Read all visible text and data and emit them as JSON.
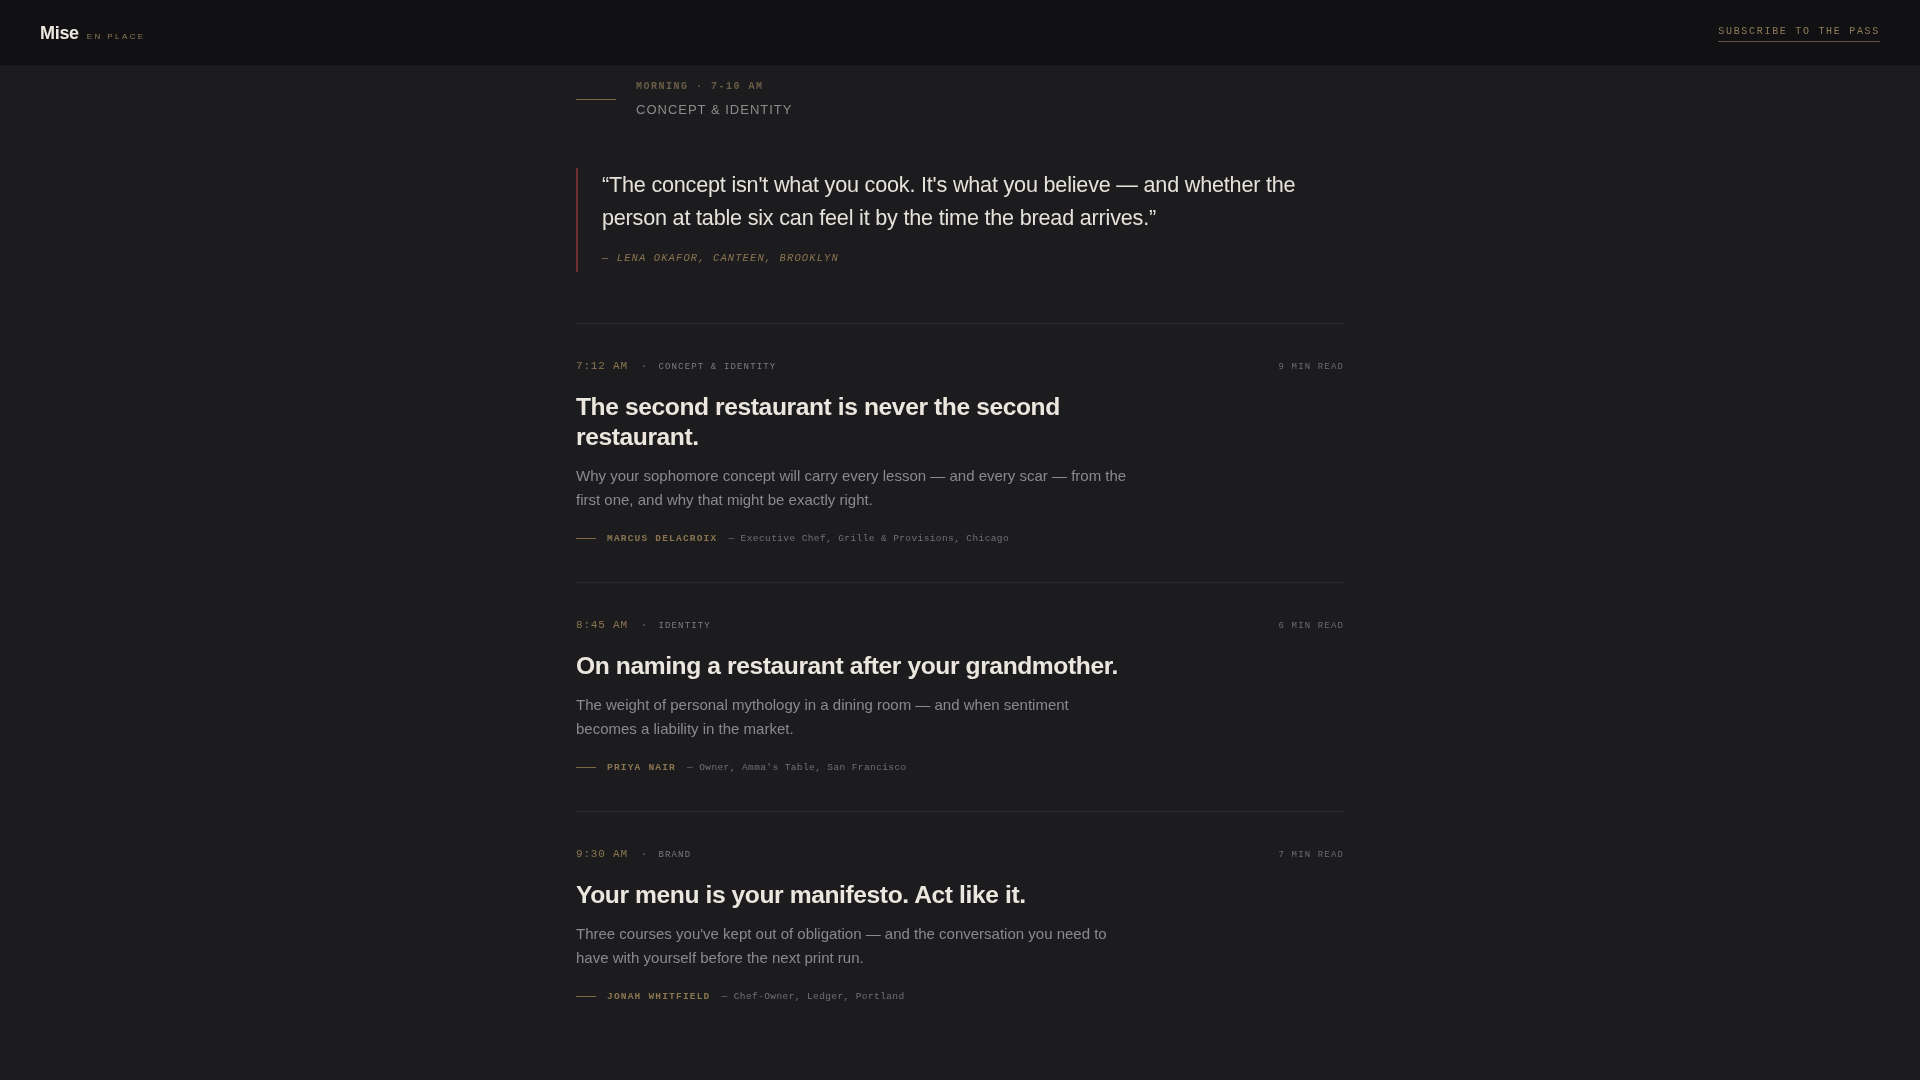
{
  "header": {
    "logo": "Mise",
    "tagline": "EN PLACE",
    "subscribe_link": "SUBSCRIBE TO THE PASS"
  },
  "section": {
    "time_label": "MORNING · 7-10 AM",
    "title": "CONCEPT & IDENTITY"
  },
  "quote": {
    "text": "“The concept isn't what you cook. It's what you believe — and whether the person at table six can feel it by the time the bread arrives.”",
    "attribution": "— LENA OKAFOR, CANTEEN, BROOKLYN"
  },
  "articles": [
    {
      "time": "7:12 AM",
      "separator": "·",
      "category": "CONCEPT & IDENTITY",
      "read_time": "9 MIN READ",
      "title": "The second restaurant is never the second restaurant.",
      "summary": "Why your sophomore concept will carry every lesson — and every scar — from the first one, and why that might be exactly right.",
      "author": "MARCUS DELACROIX",
      "author_role": "— Executive Chef, Grille & Provisions, Chicago"
    },
    {
      "time": "8:45 AM",
      "separator": "·",
      "category": "IDENTITY",
      "read_time": "6 MIN READ",
      "title": "On naming a restaurant after your grandmother.",
      "summary": "The weight of personal mythology in a dining room — and when sentiment becomes a liability in the market.",
      "author": "PRIYA NAIR",
      "author_role": "— Owner, Amma's Table, San Francisco"
    },
    {
      "time": "9:30 AM",
      "separator": "·",
      "category": "BRAND",
      "read_time": "7 MIN READ",
      "title": "Your menu is your manifesto. Act like it.",
      "summary": "Three courses you've kept out of obligation — and the conversation you need to have with yourself before the next print run.",
      "author": "JONAH WHITFIELD",
      "author_role": "— Chef-Owner, Ledger, Portland"
    }
  ]
}
